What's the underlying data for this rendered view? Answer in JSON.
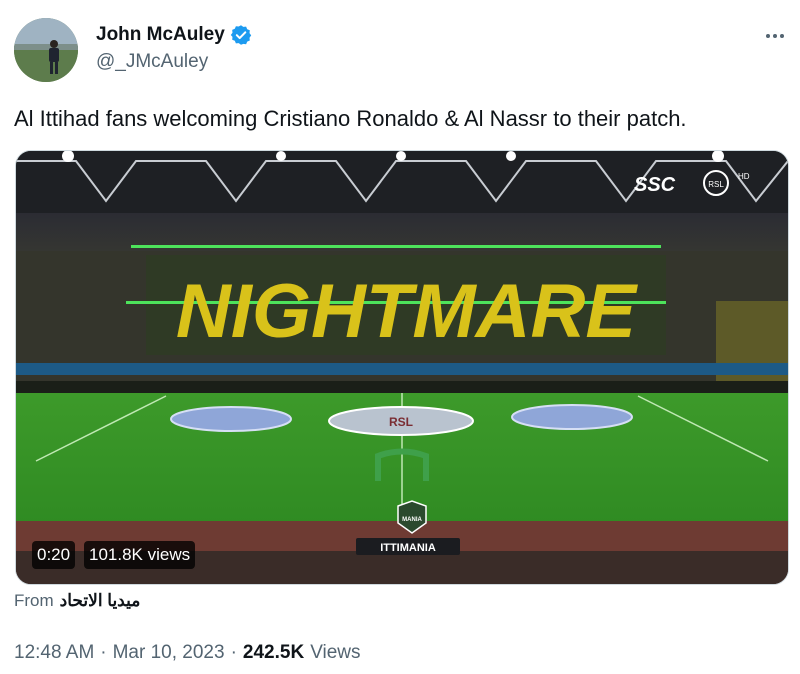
{
  "author": {
    "display_name": "John McAuley",
    "handle": "@_JMcAuley",
    "verified": true,
    "verified_color": "#1d9bf0"
  },
  "tweet": {
    "text": "Al Ittihad fans welcoming Cristiano Ronaldo & Al Nassr to their patch."
  },
  "video": {
    "duration": "0:20",
    "views": "101.8K views",
    "overlay": {
      "broadcaster_logo": "SSC",
      "league_badge": "RSL",
      "hd_tag": "HD",
      "tifo_text": "NIGHTMARE",
      "center_circle_text": "RSL",
      "sponsor_badge": "MANIA",
      "handle_banner": "ITTIMANIA"
    }
  },
  "source": {
    "prefix": "From",
    "name": "ميديا الاتحاد"
  },
  "meta": {
    "time": "12:48 AM",
    "date": "Mar 10, 2023",
    "separator": "·",
    "views_count": "242.5K",
    "views_label": "Views"
  },
  "icons": [
    "verified-badge-icon",
    "more-options-icon"
  ]
}
